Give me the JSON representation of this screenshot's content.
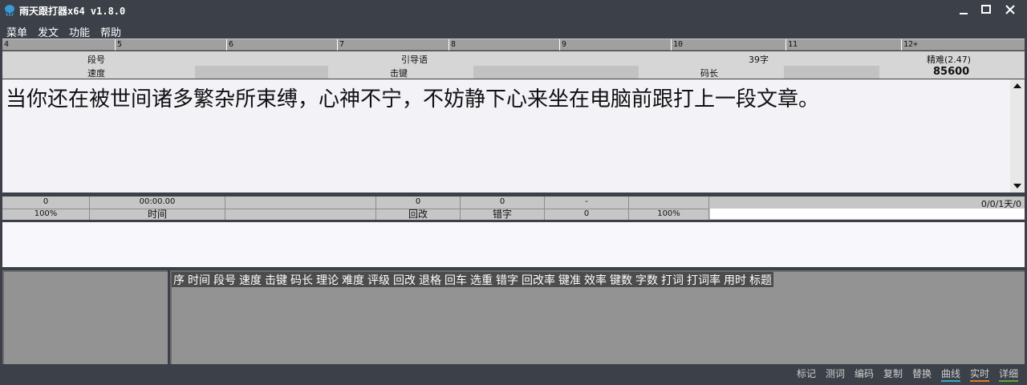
{
  "window": {
    "title": "雨天跟打器x64 v1.8.0",
    "controls": {
      "minimize": "—",
      "maximize": "□",
      "close": "✕"
    }
  },
  "menu": [
    "菜单",
    "发文",
    "功能",
    "帮助"
  ],
  "ruler": [
    "4",
    "5",
    "6",
    "7",
    "8",
    "9",
    "10",
    "11",
    "12+"
  ],
  "info": {
    "segment_label": "段号",
    "guide_label": "引导语",
    "char_count": "39字",
    "difficulty": "精难(2.47)",
    "speed_label": "速度",
    "keystroke_label": "击键",
    "codelen_label": "码长",
    "codelen_value": "85600"
  },
  "article": {
    "text": "当你还在被世间诸多繁杂所束缚，心神不宁，不妨静下心来坐在电脑前跟打上一段文章。"
  },
  "stats": {
    "typed_count": "0",
    "accuracy": "100%",
    "time_value": "00:00.00",
    "time_label": "时间",
    "backspace_value": "0",
    "backspace_label": "回改",
    "error_value": "0",
    "error_label": "错字",
    "dash_value": "-",
    "zero_value": "0",
    "percent_value": "100%",
    "progress_text": "0/0/1天/0"
  },
  "grid": {
    "columns": [
      "序",
      "时间",
      "段号",
      "速度",
      "击键",
      "码长",
      "理论",
      "难度",
      "评级",
      "回改",
      "退格",
      "回车",
      "选重",
      "错字",
      "回改率",
      "键准",
      "效率",
      "键数",
      "字数",
      "打词",
      "打词率",
      "用时",
      "标题"
    ]
  },
  "statusbar": {
    "items": [
      {
        "label": "标记",
        "underline": ""
      },
      {
        "label": "测词",
        "underline": ""
      },
      {
        "label": "编码",
        "underline": ""
      },
      {
        "label": "复制",
        "underline": ""
      },
      {
        "label": "替换",
        "underline": ""
      },
      {
        "label": "曲线",
        "underline": "#3aa8c8"
      },
      {
        "label": "实时",
        "underline": "#e07a20"
      },
      {
        "label": "详细",
        "underline": "#5aa83a"
      }
    ]
  }
}
